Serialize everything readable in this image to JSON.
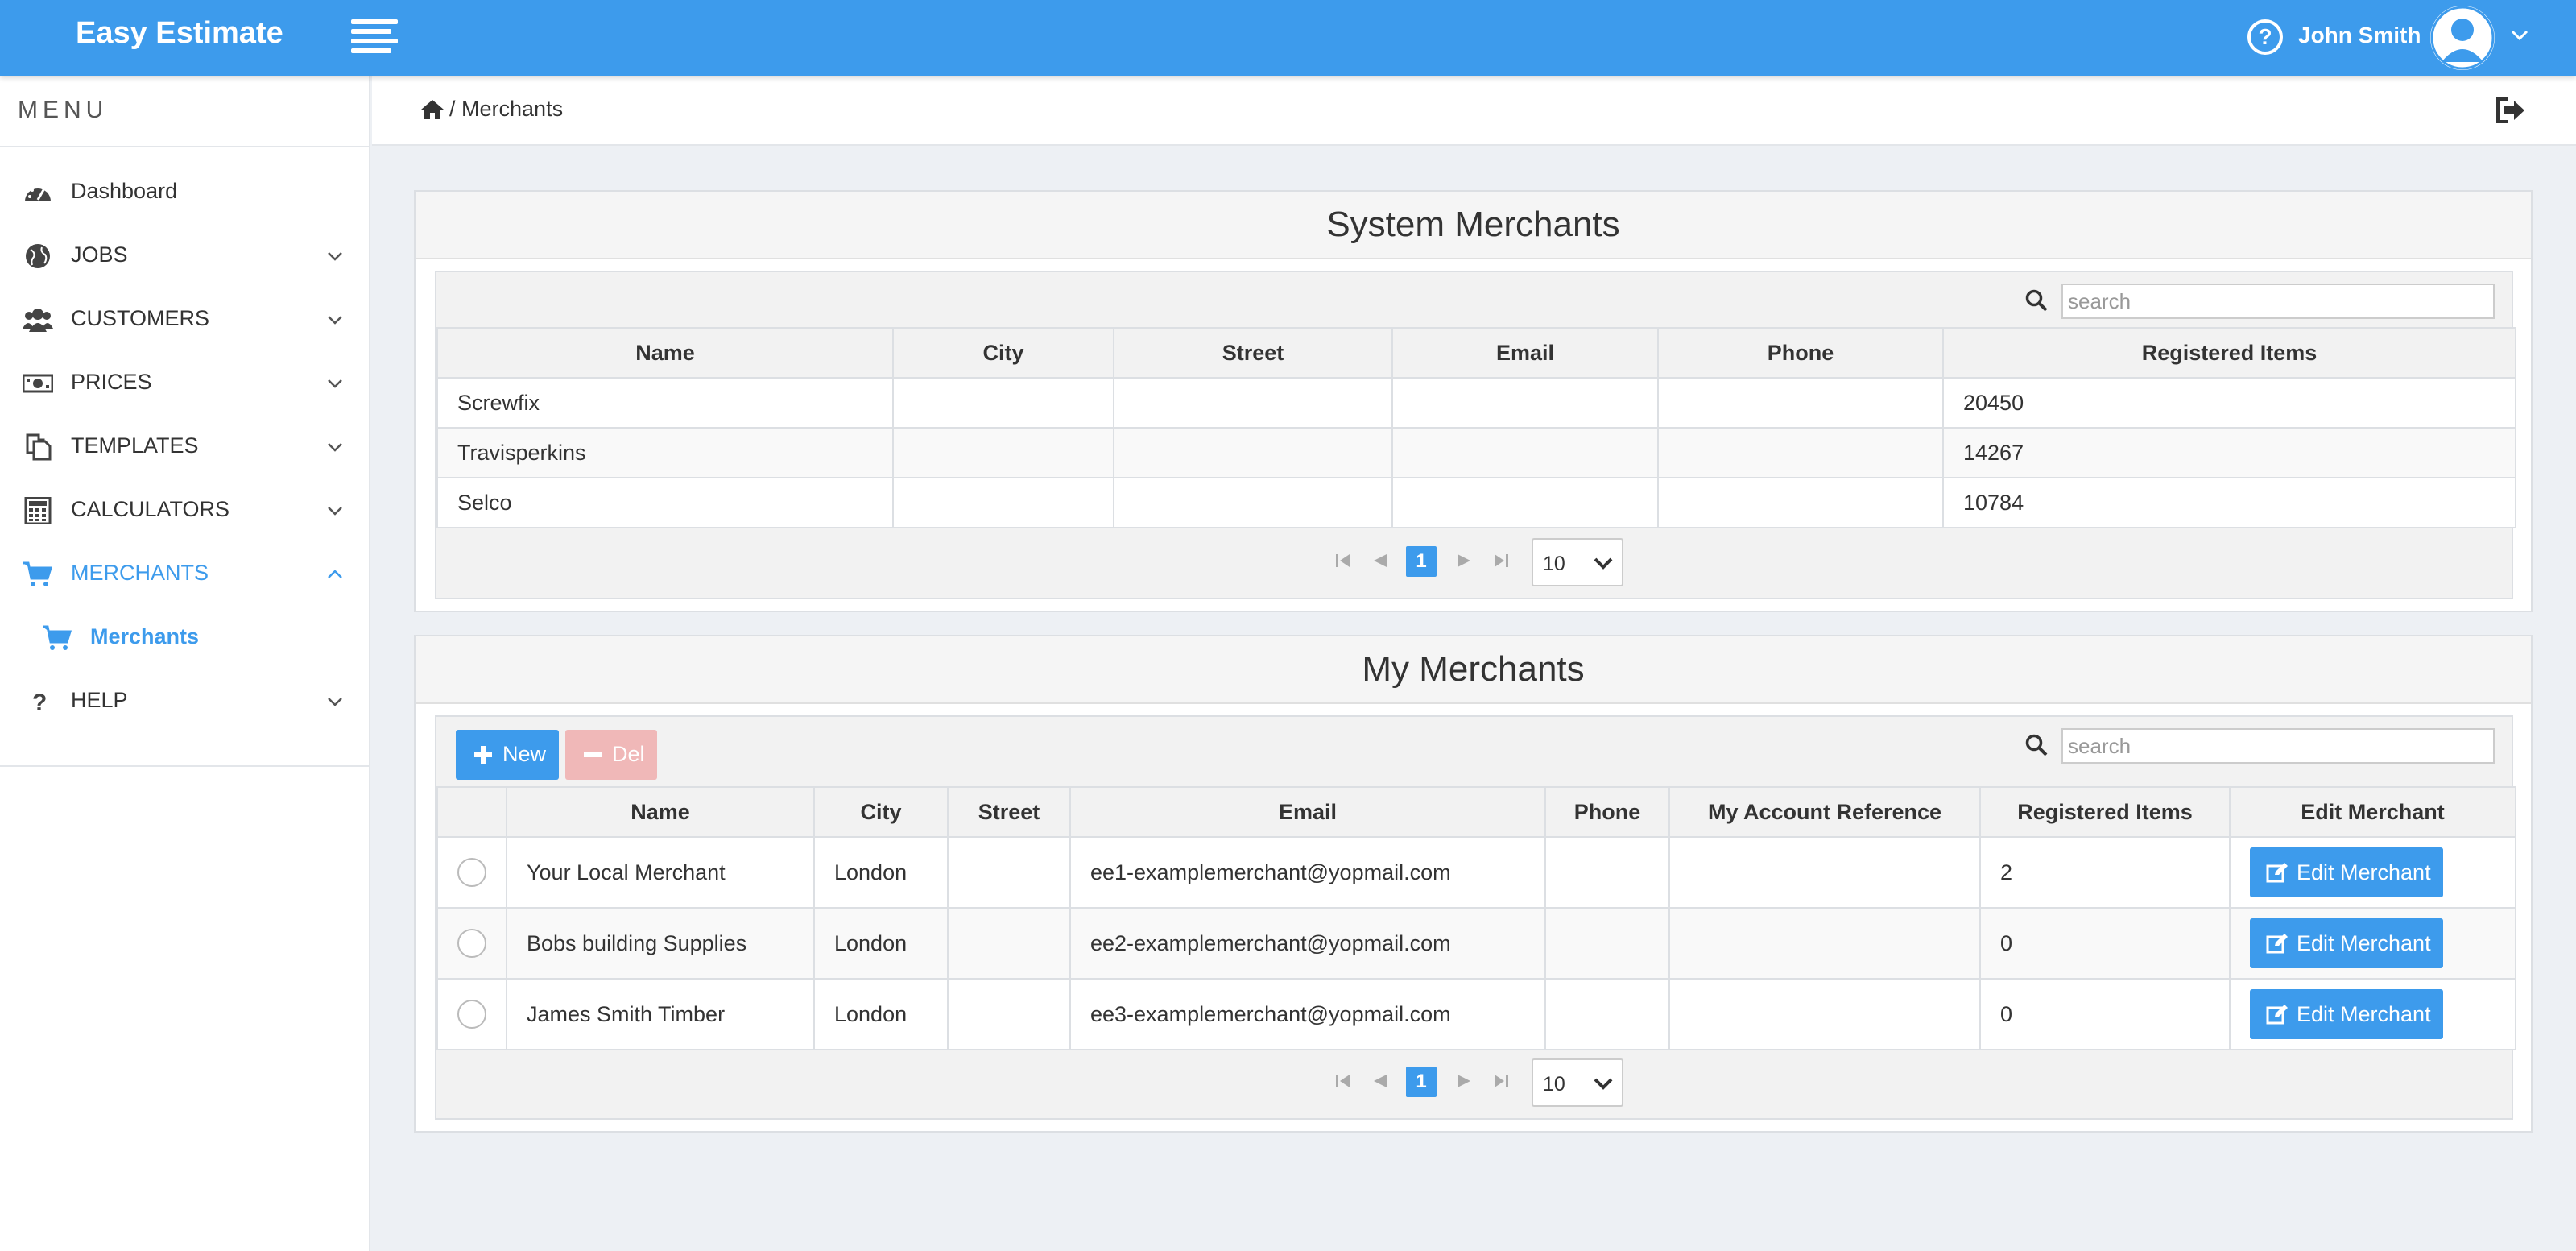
{
  "app": {
    "brand": "Easy Estimate"
  },
  "header": {
    "user_name": "John Smith"
  },
  "sidebar": {
    "menu_title": "MENU",
    "items": [
      {
        "label": "Dashboard",
        "icon": "dashboard-icon"
      },
      {
        "label": "JOBS",
        "icon": "globe-icon"
      },
      {
        "label": "CUSTOMERS",
        "icon": "users-icon"
      },
      {
        "label": "PRICES",
        "icon": "money-icon"
      },
      {
        "label": "TEMPLATES",
        "icon": "copy-icon"
      },
      {
        "label": "CALCULATORS",
        "icon": "calculator-icon"
      },
      {
        "label": "MERCHANTS",
        "icon": "cart-icon",
        "active": true
      },
      {
        "label": "HELP",
        "icon": "question-icon"
      }
    ],
    "subitem": {
      "label": "Merchants",
      "icon": "cart-icon"
    }
  },
  "breadcrumb": {
    "separator": "/",
    "current": "Merchants"
  },
  "system_merchants": {
    "title": "System Merchants",
    "search_placeholder": "search",
    "columns": [
      "Name",
      "City",
      "Street",
      "Email",
      "Phone",
      "Registered Items"
    ],
    "rows": [
      [
        "Screwfix",
        "",
        "",
        "",
        "",
        "20450"
      ],
      [
        "Travisperkins",
        "",
        "",
        "",
        "",
        "14267"
      ],
      [
        "Selco",
        "",
        "",
        "",
        "",
        "10784"
      ]
    ],
    "pager": {
      "current_page": "1",
      "page_size": "10"
    }
  },
  "my_merchants": {
    "title": "My Merchants",
    "new_label": "New",
    "del_label": "Del",
    "search_placeholder": "search",
    "columns": [
      "",
      "Name",
      "City",
      "Street",
      "Email",
      "Phone",
      "My Account Reference",
      "Registered Items",
      "Edit Merchant"
    ],
    "rows": [
      [
        "Your Local Merchant",
        "London",
        "",
        "ee1-examplemerchant@yopmail.com",
        "",
        "",
        "2"
      ],
      [
        "Bobs building Supplies",
        "London",
        "",
        "ee2-examplemerchant@yopmail.com",
        "",
        "",
        "0"
      ],
      [
        "James Smith Timber",
        "London",
        "",
        "ee3-examplemerchant@yopmail.com",
        "",
        "",
        "0"
      ]
    ],
    "edit_label": "Edit Merchant",
    "pager": {
      "current_page": "1",
      "page_size": "10"
    }
  },
  "colors": {
    "primary": "#3d9bec",
    "danger_disabled": "#f0b8b8",
    "background": "#edf0f4"
  }
}
